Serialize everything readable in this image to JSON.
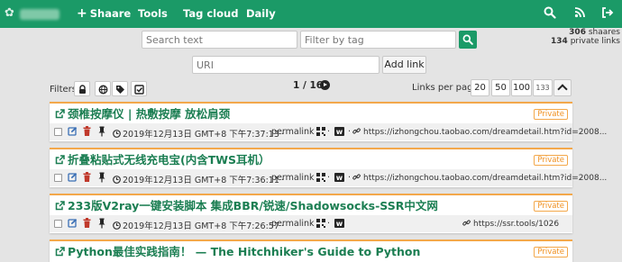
{
  "nav": {
    "shaare": "Shaare",
    "tools": "Tools",
    "tag_cloud": "Tag cloud",
    "daily": "Daily",
    "icons": [
      "search-icon",
      "rss-icon",
      "logout-icon"
    ]
  },
  "search": {
    "text_placeholder": "Search text",
    "tag_placeholder": "Filter by tag",
    "uri_placeholder": "URI",
    "add_link": "Add link"
  },
  "counts": {
    "shaares": "306",
    "shaares_label": "shaares",
    "private": "134",
    "private_label": "private links"
  },
  "filters": {
    "label": "Filters",
    "icons": [
      "private-filter-icon",
      "public-filter-icon",
      "untagged-filter-icon",
      "selection-filter-icon"
    ]
  },
  "pagination": {
    "page": "1 / 16"
  },
  "links_per_page": {
    "label": "Links per page",
    "options": [
      "20",
      "50",
      "100"
    ],
    "custom": "133"
  },
  "links": [
    {
      "title": "颈椎按摩仪 | 热敷按摩 放松肩颈",
      "private": "Private",
      "date": "2019年12月13日 GMT+8 下午7:37:13",
      "permalink": "permalink",
      "url": "https://izhongchou.taobao.com/dreamdetail.htm?id=2008..."
    },
    {
      "title": "折叠粘贴式无线充电宝(内含TWS耳机）",
      "private": "Private",
      "date": "2019年12月13日 GMT+8 下午7:36:11",
      "permalink": "permalink",
      "url": "https://izhongchou.taobao.com/dreamdetail.htm?id=2008..."
    },
    {
      "title": "233版V2ray一键安装脚本 集成BBR/锐速/Shadowsocks-SSR中文网",
      "private": "Private",
      "date": "2019年12月13日 GMT+8 下午7:26:57",
      "permalink": "permalink",
      "url": "https://ssr.tools/1026"
    },
    {
      "title": "Python最佳实践指南！ — The Hitchhiker's Guide to Python",
      "private": "Private"
    }
  ],
  "colors": {
    "brand": "#1b9a67",
    "accent": "#f3a84b",
    "title": "#1b7e52"
  }
}
